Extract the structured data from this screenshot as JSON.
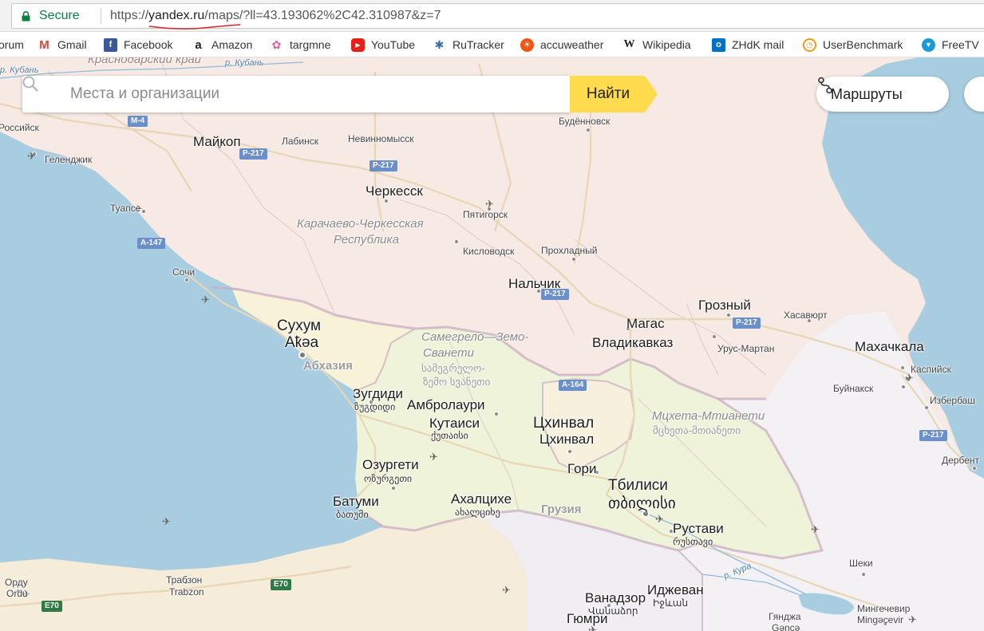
{
  "browser": {
    "security_label": "Secure",
    "url_scheme": "https://",
    "url_host": "yandex.ru",
    "url_path": "/maps/?ll=43.193062%2C42.310987&z=7"
  },
  "bookmarks": [
    {
      "label": "orum",
      "icon": "generic-page-icon",
      "color": "#888888"
    },
    {
      "label": "Gmail",
      "icon": "gmail-icon",
      "color": "#d44638"
    },
    {
      "label": "Facebook",
      "icon": "facebook-icon",
      "color": "#3b5998"
    },
    {
      "label": "Amazon",
      "icon": "amazon-icon",
      "color": "#222222"
    },
    {
      "label": "targmne",
      "icon": "targmne-icon",
      "color": "#e05ca8"
    },
    {
      "label": "YouTube",
      "icon": "youtube-icon",
      "color": "#e62117"
    },
    {
      "label": "RuTracker",
      "icon": "rutracker-icon",
      "color": "#3a6ea5"
    },
    {
      "label": "accuweather",
      "icon": "accuweather-icon",
      "color": "#f05514"
    },
    {
      "label": "Wikipedia",
      "icon": "wikipedia-icon",
      "color": "#222222"
    },
    {
      "label": "ZHdK mail",
      "icon": "outlook-icon",
      "color": "#0072c6"
    },
    {
      "label": "UserBenchmark",
      "icon": "userbenchmark-icon",
      "color": "#f29b1d"
    },
    {
      "label": "FreeTV",
      "icon": "freetv-icon",
      "color": "#1a9bd7"
    }
  ],
  "search": {
    "placeholder": "Места и организации",
    "button_label": "Найти"
  },
  "routes": {
    "label": "Маршруты"
  },
  "map": {
    "colors": {
      "sea": "#a9cde0",
      "russia": "#f7e9e3",
      "georgia": "#eef3d9",
      "abkhazia": "#f8f2d9",
      "south_ossetia": "#f6f0dc",
      "turkey": "#f6ecda",
      "armenia_azerbaijan": "#f0eef2",
      "border": "#c9a9c0",
      "river": "#8ebcd9",
      "road": "#e8d6b5"
    },
    "labels": {
      "krasnodar_krai": "Краснодарский край",
      "kuban": "р. Кубань",
      "kuban2": "р. Кубань",
      "rossiysk": "Российск",
      "gelendzhik": "Геленджик",
      "maykop": "Майкоп",
      "labinsk": "Лабинск",
      "nevinnomyssk": "Невинномысск",
      "budennovsk": "Будённовск",
      "tuapse": "Туапсе",
      "cherkessk": "Черкесск",
      "pyatigorsk": "Пятигорск",
      "kchr": "Карачаево-Черкесская",
      "kchr2": "Республика",
      "kislovodsk": "Кисловодск",
      "prokhladny": "Прохладный",
      "sochi": "Сочи",
      "nalchik": "Нальчик",
      "grozny": "Грозный",
      "khasavyurt": "Хасавюрт",
      "sukhum": "Сухум",
      "akua": "Аҟәа",
      "magas": "Магас",
      "vladikavkaz": "Владикавказ",
      "urus_martan": "Урус-Мартан",
      "makhachkala": "Махачкала",
      "kaspiysk": "Каспийск",
      "abkhazia": "Абхазия",
      "samegrelo": "Самегрело—Земо-",
      "svaneti": "Сванети",
      "samegrelo_geo": "სამეგრელო-",
      "svaneti_geo": "ზემო სვანეთი",
      "buynaksk": "Буйнакск",
      "izberbash": "Избербаш",
      "zugdidi": "Зугдиди",
      "zugdidi_geo": "ზუგდიდი",
      "ambrolauri": "Амбролаури",
      "kutaisi": "Кутаиси",
      "kutaisi_geo": "ქუთაისი",
      "tskhinval": "Цхинвал",
      "tskhinval2": "Цхинвал",
      "mtskheta": "Мцхета-Мтианети",
      "mtskheta_geo": "მცხეთა-მთიანეთი",
      "ozurgeti": "Озургети",
      "ozurgeti_geo": "ოზურგეთი",
      "gori": "Гори",
      "tbilisi": "Тбилиси",
      "tbilisi_geo": "თბილისი",
      "derbent": "Дербент",
      "batumi": "Батуми",
      "batumi_geo": "ბათუმი",
      "akhaltsikhe": "Ахалцихе",
      "akhaltsikhe_geo": "ახალციხე",
      "georgia": "Грузия",
      "rustavi": "Рустави",
      "rustavi_geo": "რუსთავი",
      "sheki": "Шеки",
      "kura": "р. Кура",
      "ordu": "Орду",
      "ordu_lat": "Ordu",
      "trabzon": "Трабзон",
      "trabzon_lat": "Trabzon",
      "vanadzor": "Ванадзор",
      "vanadzor_arm": "Վանաձոր",
      "ijevan": "Иджеван",
      "ijevan_arm": "Իջևան",
      "mingachevir": "Мингечевир",
      "mingachevir_lat": "Mingəçevir",
      "gyumri": "Гюмри",
      "ganja": "Гянджа",
      "ganja_lat": "Gəncə"
    },
    "roads": {
      "m4": "M-4",
      "r217a": "P-217",
      "r217b": "P-217",
      "a147": "A-147",
      "r217c": "P-217",
      "r217d": "P-217",
      "a164": "A-164",
      "r217e": "P-217",
      "e70a": "E70",
      "e70b": "E70"
    }
  }
}
